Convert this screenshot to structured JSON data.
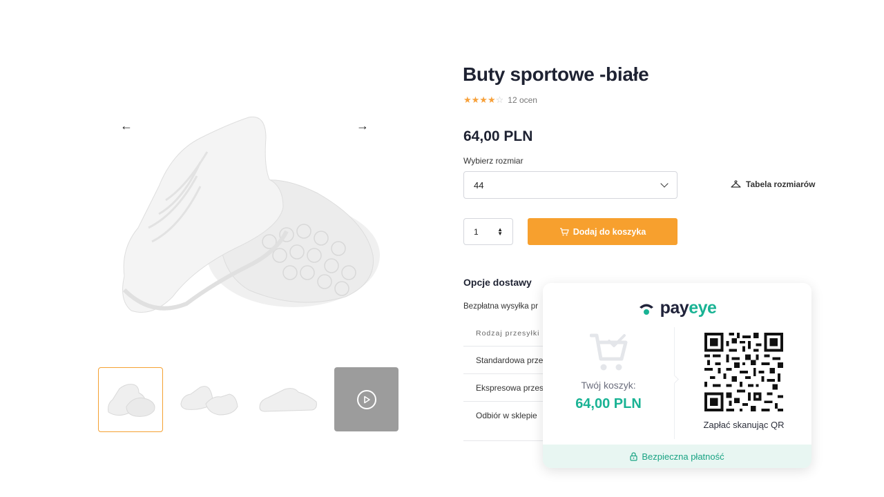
{
  "product": {
    "title": "Buty sportowe -białe",
    "rating_count": "12 ocen",
    "rating": 4,
    "rating_max": 5,
    "price": "64,00 PLN",
    "size_label": "Wybierz rozmiar",
    "size_value": "44",
    "size_table_label": "Tabela rozmiarów",
    "quantity": "1",
    "add_to_cart_label": "Dodaj do koszyka",
    "accent_color": "#f7a02e"
  },
  "gallery": {
    "thumb_count": 4,
    "active_thumb": 0,
    "last_thumb_is_video": true
  },
  "delivery": {
    "title": "Opcje dostawy",
    "free_shipping_text": "Bezpłatna wysyłka pr",
    "table_header": "Rodzaj przesyłki",
    "options": [
      "Standardowa prze",
      "Ekspresowa  przes",
      "Odbiór w sklepie"
    ]
  },
  "payeye": {
    "logo_pay": "pay",
    "logo_eye": "eye",
    "cart_label": "Twój koszyk:",
    "cart_total": "64,00 PLN",
    "qr_label": "Zapłać skanując QR",
    "secure_label": "Bezpieczna płatność",
    "brand_color": "#19b394"
  }
}
